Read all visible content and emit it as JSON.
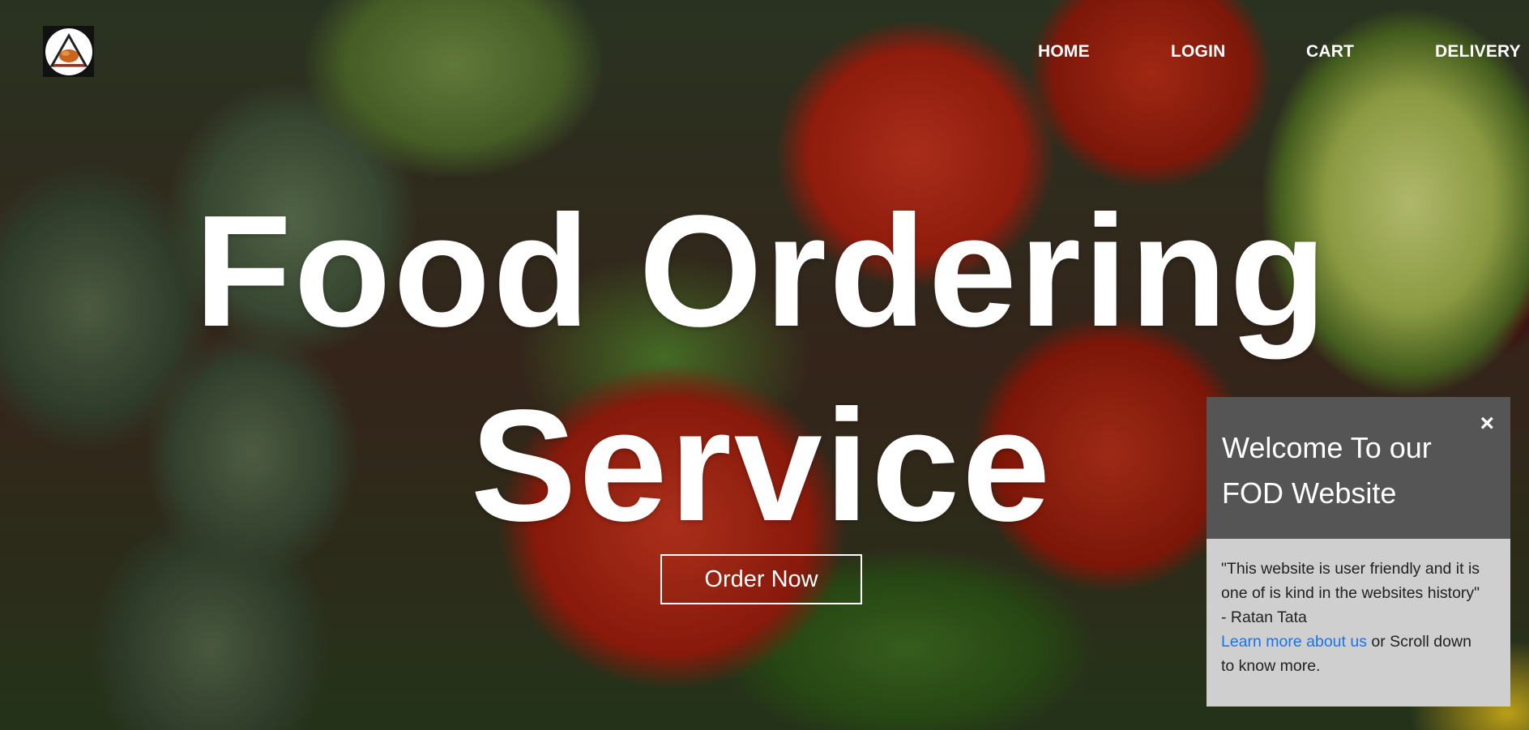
{
  "nav": {
    "items": [
      "HOME",
      "LOGIN",
      "CART",
      "DELIVERY"
    ]
  },
  "hero": {
    "headline_line1": "Food Ordering",
    "headline_line2": "Service",
    "cta_label": "Order Now"
  },
  "popup": {
    "title_line1": "Welcome To our",
    "title_line2": "FOD Website",
    "close_label": "×",
    "quote_line1": "\"This website is user friendly and it is",
    "quote_line2": "one of is kind in the websites history\"",
    "author": "- Ratan Tata",
    "link_text": "Learn more about us",
    "after_link": " or Scroll down",
    "last_line": "to know more."
  },
  "colors": {
    "popup_header": "#555555",
    "popup_body": "#cfcfcf",
    "link": "#1a73e8"
  },
  "icons": {
    "logo": "food-logo-icon",
    "close": "close-icon"
  }
}
